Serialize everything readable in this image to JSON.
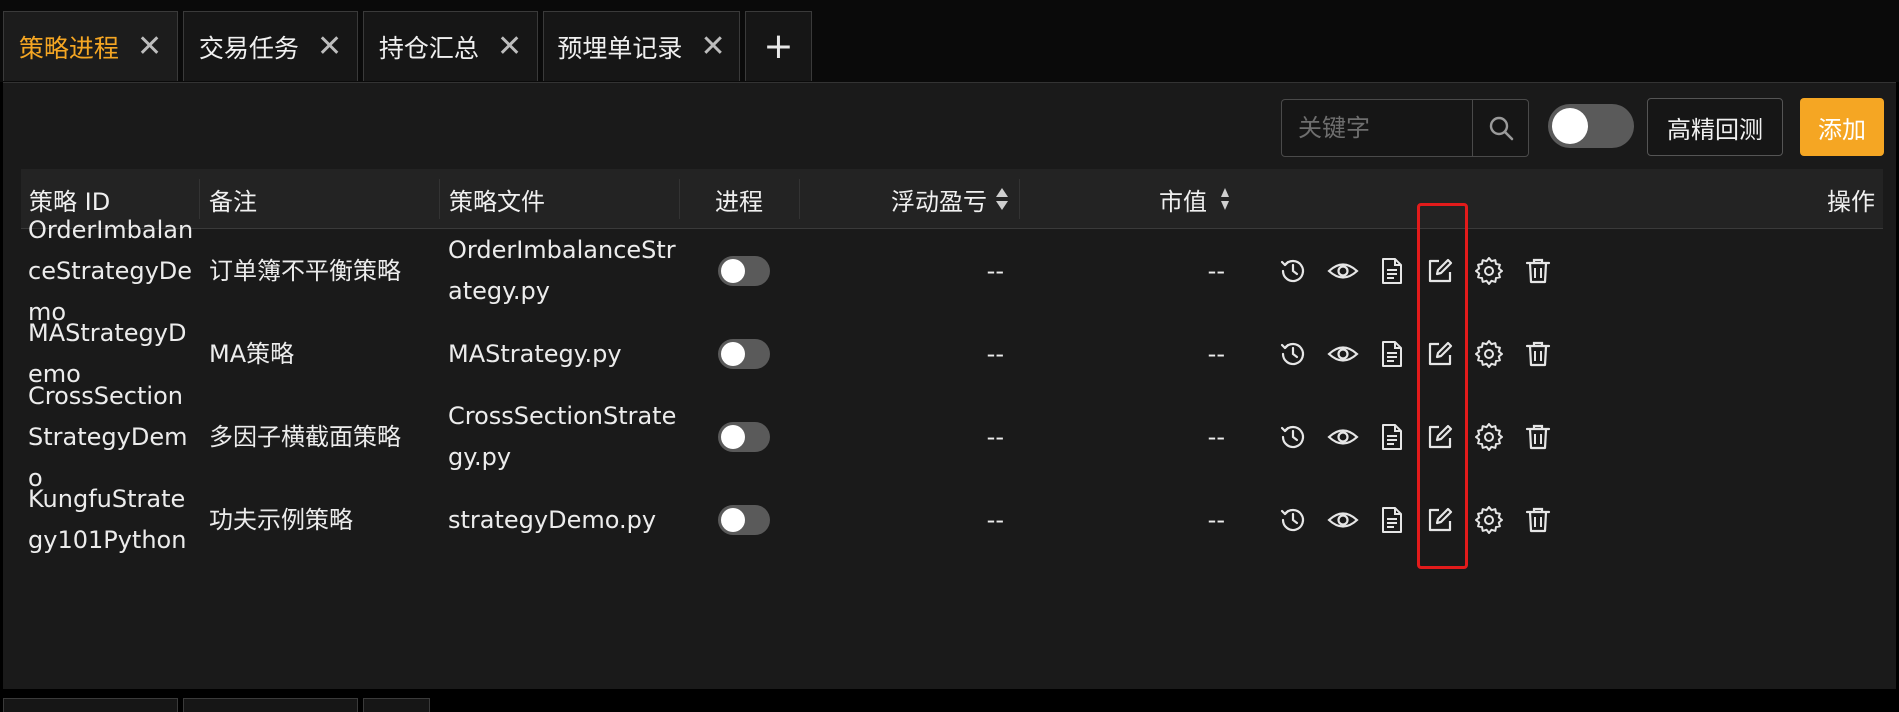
{
  "tabs": [
    {
      "label": "策略进程",
      "closable": true,
      "active": true
    },
    {
      "label": "交易任务",
      "closable": true,
      "active": false
    },
    {
      "label": "持仓汇总",
      "closable": true,
      "active": false
    },
    {
      "label": "预埋单记录",
      "closable": true,
      "active": false
    }
  ],
  "tab_add_label": "+",
  "tab_close_glyph": "✕",
  "toolbar": {
    "search_placeholder": "关键字",
    "search_value": "",
    "toggle_on": false,
    "backtest_label": "高精回测",
    "add_label": "添加"
  },
  "table": {
    "columns": [
      "策略 ID",
      "备注",
      "策略文件",
      "进程",
      "浮动盈亏",
      "市值",
      "操作"
    ],
    "rows": [
      {
        "id": "OrderImbalanceStrategyDemo",
        "note": "订单簿不平衡策略",
        "file": "OrderImbalanceStrategy.py",
        "running": false,
        "pnl": "--",
        "market_value": "--"
      },
      {
        "id": "MAStrategyDemo",
        "note": "MA策略",
        "file": "MAStrategy.py",
        "running": false,
        "pnl": "--",
        "market_value": "--"
      },
      {
        "id": "CrossSectionStrategyDemo",
        "note": "多因子横截面策略",
        "file": "CrossSectionStrategy.py",
        "running": false,
        "pnl": "--",
        "market_value": "--"
      },
      {
        "id": "KungfuStrategy101Python",
        "note": "功夫示例策略",
        "file": "strategyDemo.py",
        "running": false,
        "pnl": "--",
        "market_value": "--"
      }
    ],
    "actions": [
      "history-icon",
      "eye-icon",
      "file-icon",
      "edit-icon",
      "gear-icon",
      "trash-icon"
    ]
  },
  "colors": {
    "accent": "#f5a623",
    "highlight": "#e21b1b",
    "panel_bg": "#1a1a1a",
    "header_bg": "#232323"
  }
}
